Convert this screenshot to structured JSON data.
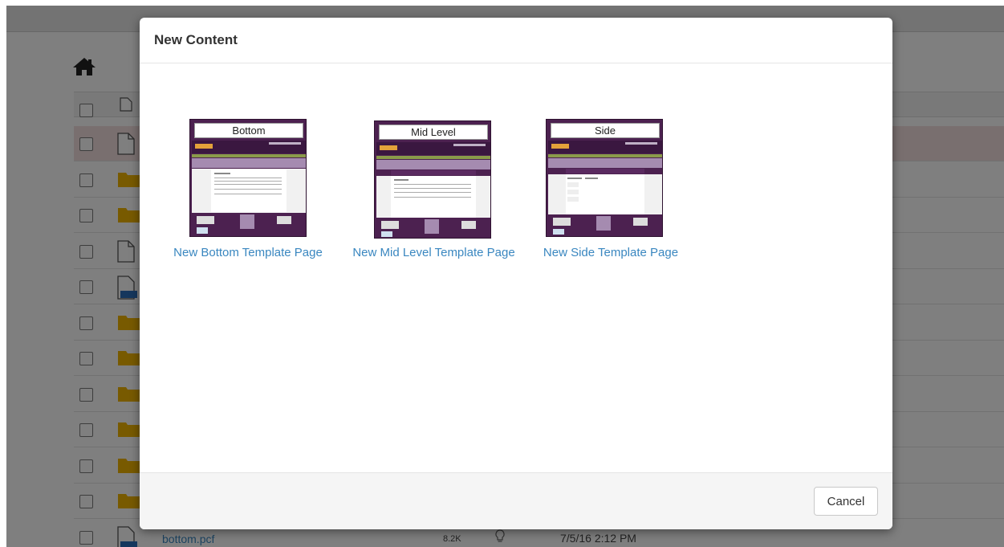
{
  "modal": {
    "title": "New Content",
    "cancel_label": "Cancel",
    "templates": [
      {
        "thumb_label": "Bottom",
        "link_label": "New Bottom Template Page"
      },
      {
        "thumb_label": "Mid Level",
        "link_label": "New Mid Level Template Page"
      },
      {
        "thumb_label": "Side",
        "link_label": "New Side Template Page"
      }
    ]
  },
  "background": {
    "last_row": {
      "name": "bottom.pcf",
      "size": "8.2K",
      "date": "7/5/16 2:12 PM"
    }
  },
  "colors": {
    "thumbnail_purple": "#4c2150",
    "link_blue": "#3a87c0",
    "folder_yellow": "#f0b400",
    "selected_row": "#f2dede"
  }
}
